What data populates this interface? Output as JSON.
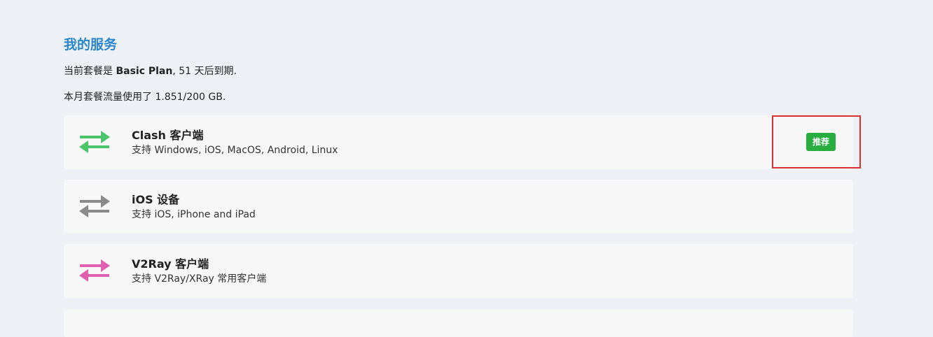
{
  "section": {
    "title": "我的服务"
  },
  "plan": {
    "line1_prefix": "当前套餐是 ",
    "plan_name": "Basic Plan",
    "line1_suffix": ", 51 天后到期.",
    "line2": "本月套餐流量使用了 1.851/200 GB."
  },
  "clients": [
    {
      "name": "Clash 客户端",
      "desc": "支持 Windows, iOS, MacOS, Android, Linux",
      "badge": "推荐",
      "icon": "swap-arrows-icon",
      "color": "#4cc46a"
    },
    {
      "name": "iOS 设备",
      "desc": "支持 iOS, iPhone and iPad",
      "icon": "swap-arrows-icon",
      "color": "#8a8a8a"
    },
    {
      "name": "V2Ray 客户端",
      "desc": "支持 V2Ray/XRay 常用客户端",
      "icon": "swap-arrows-icon",
      "color": "#e05fb1"
    }
  ],
  "colors": {
    "title": "#2b86c9",
    "badge": "#27ae3f",
    "highlight": "#d93030",
    "background": "#edf1f5",
    "card": "#f7f7f7"
  }
}
